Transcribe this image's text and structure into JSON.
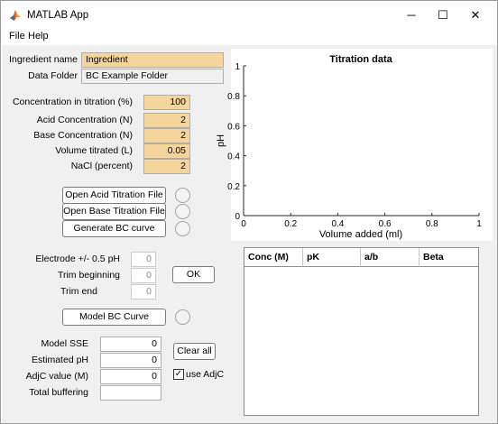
{
  "window": {
    "title": "MATLAB App",
    "minimize": "─",
    "maximize": "☐",
    "close": "✕"
  },
  "menu": [
    "File",
    "Help"
  ],
  "ingredient": {
    "label": "Ingredient name",
    "value": "Ingredient"
  },
  "data_folder": {
    "label": "Data Folder",
    "value": "BC Example Folder"
  },
  "params": [
    {
      "label": "Concentration in titration (%)",
      "value": "100"
    },
    {
      "label": "Acid Concentration (N)",
      "value": "2"
    },
    {
      "label": "Base Concentration (N)",
      "value": "2"
    },
    {
      "label": "Volume titrated (L)",
      "value": "0.05"
    },
    {
      "label": "NaCl (percent)",
      "value": "2"
    }
  ],
  "buttons": {
    "open_acid": "Open Acid Titration File",
    "open_base": "Open Base Titration File",
    "generate": "Generate BC curve",
    "ok": "OK",
    "model": "Model BC Curve",
    "clear": "Clear all"
  },
  "trim": [
    {
      "label": "Electrode +/- 0.5 pH",
      "value": "0"
    },
    {
      "label": "Trim beginning",
      "value": "0"
    },
    {
      "label": "Trim end",
      "value": "0"
    }
  ],
  "results": [
    {
      "label": "Model SSE",
      "value": "0"
    },
    {
      "label": "Estimated pH",
      "value": "0"
    },
    {
      "label": "AdjC value (M)",
      "value": "0"
    },
    {
      "label": "Total buffering",
      "value": ""
    }
  ],
  "use_adjc": {
    "label": "use AdjC",
    "checked": true
  },
  "chart_data": {
    "type": "line",
    "title": "Titration data",
    "xlabel": "Volume added (ml)",
    "ylabel": "pH",
    "xlim": [
      0,
      1
    ],
    "ylim": [
      0,
      1
    ],
    "xticks": [
      "0",
      "0.2",
      "0.4",
      "0.6",
      "0.8",
      "1"
    ],
    "yticks": [
      "0",
      "0.2",
      "0.4",
      "0.6",
      "0.8",
      "1"
    ],
    "series": []
  },
  "table": {
    "columns": [
      "Conc (M)",
      "pK",
      "a/b",
      "Beta"
    ],
    "rows": []
  }
}
